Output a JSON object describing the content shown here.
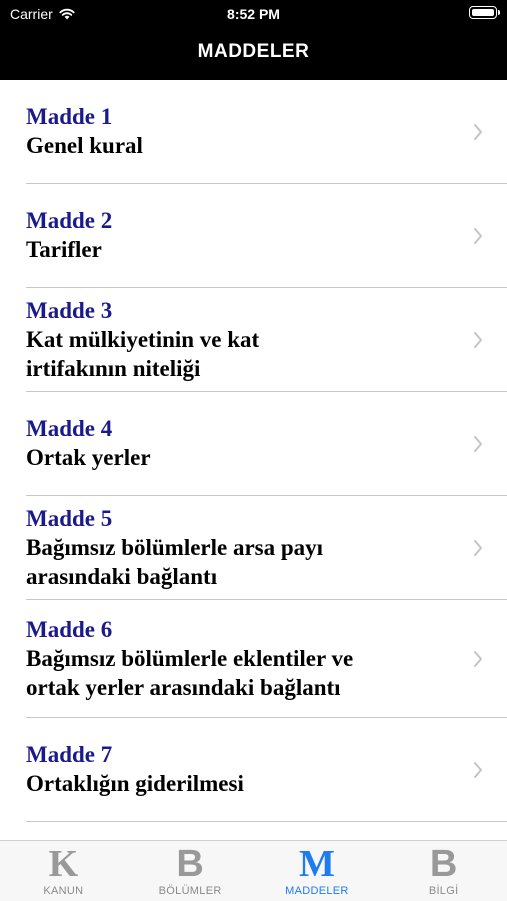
{
  "status": {
    "carrier": "Carrier",
    "time": "8:52 PM"
  },
  "nav": {
    "title": "MADDELER"
  },
  "articles": [
    {
      "number": "Madde 1",
      "title": [
        "Genel kural"
      ]
    },
    {
      "number": "Madde 2",
      "title": [
        "Tarifler"
      ]
    },
    {
      "number": "Madde 3",
      "title": [
        "Kat mülkiyetinin ve kat",
        "irtifakının niteliği"
      ]
    },
    {
      "number": "Madde 4",
      "title": [
        "Ortak yerler"
      ]
    },
    {
      "number": "Madde 5",
      "title": [
        "Bağımsız bölümlerle arsa payı",
        "arasındaki bağlantı"
      ]
    },
    {
      "number": "Madde 6",
      "title": [
        "Bağımsız bölümlerle eklentiler ve",
        "ortak yerler arasındaki bağlantı"
      ]
    },
    {
      "number": "Madde 7",
      "title": [
        "Ortaklığın giderilmesi"
      ]
    }
  ],
  "tabs": [
    {
      "glyph": "K",
      "label": "KANUN",
      "active": false
    },
    {
      "glyph": "B",
      "label": "BÖLÜMLER",
      "active": false
    },
    {
      "glyph": "M",
      "label": "MADDELER",
      "active": true
    },
    {
      "glyph": "B",
      "label": "BİLGİ",
      "active": false
    }
  ],
  "colors": {
    "accent": "#1e7cf0",
    "madde": "#1a1a8c",
    "inactive": "#999999"
  }
}
